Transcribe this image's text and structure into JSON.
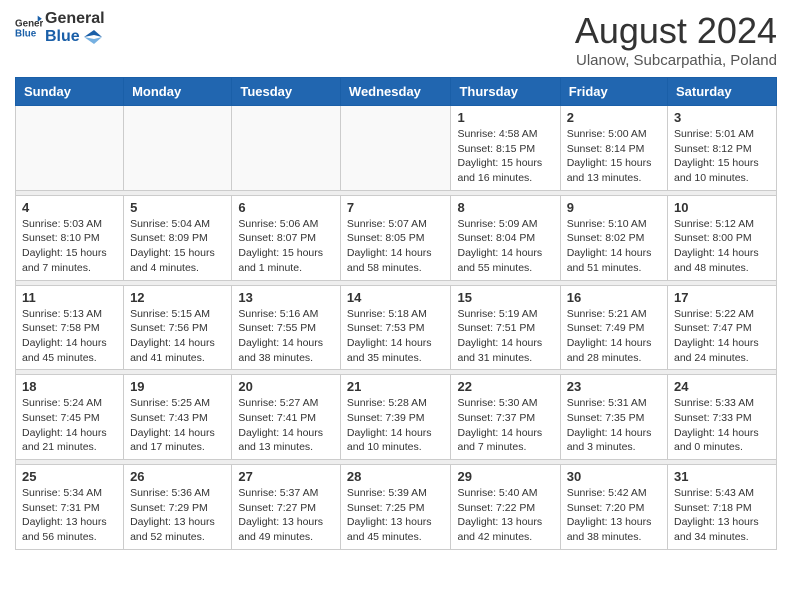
{
  "header": {
    "logo_general": "General",
    "logo_blue": "Blue",
    "month_year": "August 2024",
    "location": "Ulanow, Subcarpathia, Poland"
  },
  "weekdays": [
    "Sunday",
    "Monday",
    "Tuesday",
    "Wednesday",
    "Thursday",
    "Friday",
    "Saturday"
  ],
  "weeks": [
    [
      {
        "day": "",
        "info": ""
      },
      {
        "day": "",
        "info": ""
      },
      {
        "day": "",
        "info": ""
      },
      {
        "day": "",
        "info": ""
      },
      {
        "day": "1",
        "info": "Sunrise: 4:58 AM\nSunset: 8:15 PM\nDaylight: 15 hours\nand 16 minutes."
      },
      {
        "day": "2",
        "info": "Sunrise: 5:00 AM\nSunset: 8:14 PM\nDaylight: 15 hours\nand 13 minutes."
      },
      {
        "day": "3",
        "info": "Sunrise: 5:01 AM\nSunset: 8:12 PM\nDaylight: 15 hours\nand 10 minutes."
      }
    ],
    [
      {
        "day": "4",
        "info": "Sunrise: 5:03 AM\nSunset: 8:10 PM\nDaylight: 15 hours\nand 7 minutes."
      },
      {
        "day": "5",
        "info": "Sunrise: 5:04 AM\nSunset: 8:09 PM\nDaylight: 15 hours\nand 4 minutes."
      },
      {
        "day": "6",
        "info": "Sunrise: 5:06 AM\nSunset: 8:07 PM\nDaylight: 15 hours\nand 1 minute."
      },
      {
        "day": "7",
        "info": "Sunrise: 5:07 AM\nSunset: 8:05 PM\nDaylight: 14 hours\nand 58 minutes."
      },
      {
        "day": "8",
        "info": "Sunrise: 5:09 AM\nSunset: 8:04 PM\nDaylight: 14 hours\nand 55 minutes."
      },
      {
        "day": "9",
        "info": "Sunrise: 5:10 AM\nSunset: 8:02 PM\nDaylight: 14 hours\nand 51 minutes."
      },
      {
        "day": "10",
        "info": "Sunrise: 5:12 AM\nSunset: 8:00 PM\nDaylight: 14 hours\nand 48 minutes."
      }
    ],
    [
      {
        "day": "11",
        "info": "Sunrise: 5:13 AM\nSunset: 7:58 PM\nDaylight: 14 hours\nand 45 minutes."
      },
      {
        "day": "12",
        "info": "Sunrise: 5:15 AM\nSunset: 7:56 PM\nDaylight: 14 hours\nand 41 minutes."
      },
      {
        "day": "13",
        "info": "Sunrise: 5:16 AM\nSunset: 7:55 PM\nDaylight: 14 hours\nand 38 minutes."
      },
      {
        "day": "14",
        "info": "Sunrise: 5:18 AM\nSunset: 7:53 PM\nDaylight: 14 hours\nand 35 minutes."
      },
      {
        "day": "15",
        "info": "Sunrise: 5:19 AM\nSunset: 7:51 PM\nDaylight: 14 hours\nand 31 minutes."
      },
      {
        "day": "16",
        "info": "Sunrise: 5:21 AM\nSunset: 7:49 PM\nDaylight: 14 hours\nand 28 minutes."
      },
      {
        "day": "17",
        "info": "Sunrise: 5:22 AM\nSunset: 7:47 PM\nDaylight: 14 hours\nand 24 minutes."
      }
    ],
    [
      {
        "day": "18",
        "info": "Sunrise: 5:24 AM\nSunset: 7:45 PM\nDaylight: 14 hours\nand 21 minutes."
      },
      {
        "day": "19",
        "info": "Sunrise: 5:25 AM\nSunset: 7:43 PM\nDaylight: 14 hours\nand 17 minutes."
      },
      {
        "day": "20",
        "info": "Sunrise: 5:27 AM\nSunset: 7:41 PM\nDaylight: 14 hours\nand 13 minutes."
      },
      {
        "day": "21",
        "info": "Sunrise: 5:28 AM\nSunset: 7:39 PM\nDaylight: 14 hours\nand 10 minutes."
      },
      {
        "day": "22",
        "info": "Sunrise: 5:30 AM\nSunset: 7:37 PM\nDaylight: 14 hours\nand 7 minutes."
      },
      {
        "day": "23",
        "info": "Sunrise: 5:31 AM\nSunset: 7:35 PM\nDaylight: 14 hours\nand 3 minutes."
      },
      {
        "day": "24",
        "info": "Sunrise: 5:33 AM\nSunset: 7:33 PM\nDaylight: 14 hours\nand 0 minutes."
      }
    ],
    [
      {
        "day": "25",
        "info": "Sunrise: 5:34 AM\nSunset: 7:31 PM\nDaylight: 13 hours\nand 56 minutes."
      },
      {
        "day": "26",
        "info": "Sunrise: 5:36 AM\nSunset: 7:29 PM\nDaylight: 13 hours\nand 52 minutes."
      },
      {
        "day": "27",
        "info": "Sunrise: 5:37 AM\nSunset: 7:27 PM\nDaylight: 13 hours\nand 49 minutes."
      },
      {
        "day": "28",
        "info": "Sunrise: 5:39 AM\nSunset: 7:25 PM\nDaylight: 13 hours\nand 45 minutes."
      },
      {
        "day": "29",
        "info": "Sunrise: 5:40 AM\nSunset: 7:22 PM\nDaylight: 13 hours\nand 42 minutes."
      },
      {
        "day": "30",
        "info": "Sunrise: 5:42 AM\nSunset: 7:20 PM\nDaylight: 13 hours\nand 38 minutes."
      },
      {
        "day": "31",
        "info": "Sunrise: 5:43 AM\nSunset: 7:18 PM\nDaylight: 13 hours\nand 34 minutes."
      }
    ]
  ]
}
